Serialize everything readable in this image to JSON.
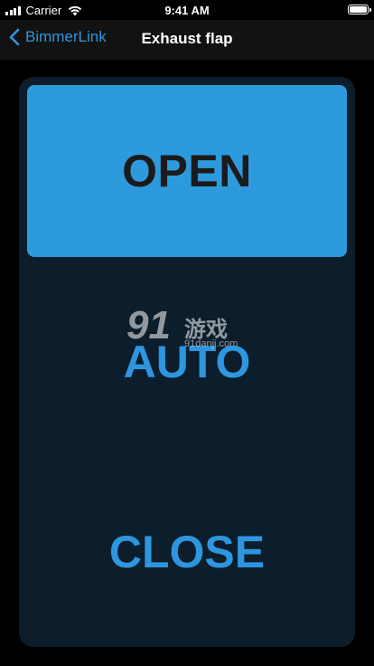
{
  "status_bar": {
    "carrier": "Carrier",
    "time": "9:41 AM"
  },
  "nav": {
    "back_label": "BimmerLink",
    "title": "Exhaust flap"
  },
  "controls": {
    "open_label": "OPEN",
    "auto_label": "AUTO",
    "close_label": "CLOSE",
    "selected": "OPEN"
  },
  "watermark": {
    "logo": "91",
    "text": "游戏",
    "url": "91danji.com"
  },
  "colors": {
    "accent": "#2e96df",
    "selected_fill": "#2e9ade",
    "panel": "#0c1d2b",
    "background": "#000000",
    "nav_bar": "#121212"
  },
  "icons": {
    "signal": "cellular-signal-icon",
    "wifi": "wifi-icon",
    "battery": "battery-icon",
    "back": "chevron-left-icon"
  }
}
